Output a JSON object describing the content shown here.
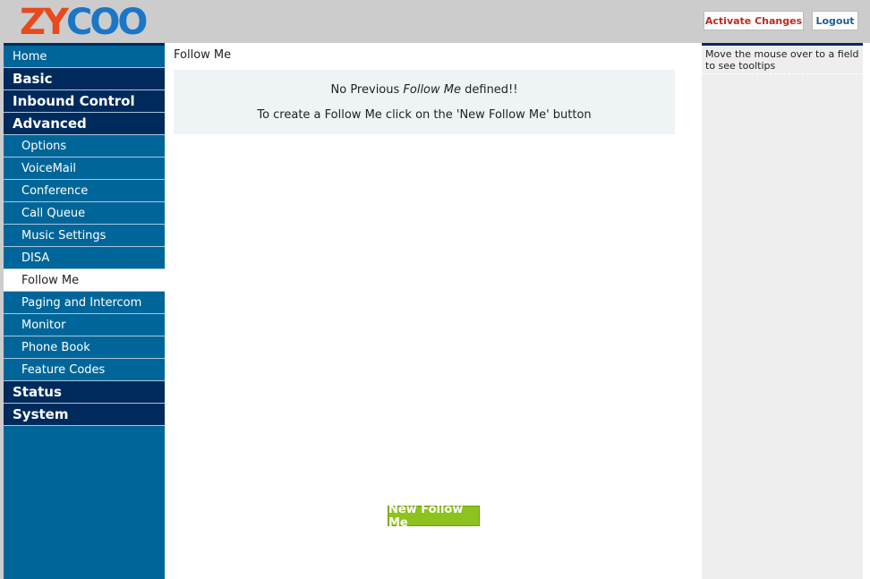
{
  "header": {
    "logo_text": "ZYCOO",
    "activate_label": "Activate Changes",
    "logout_label": "Logout"
  },
  "colors": {
    "sidebar_bg": "#006699",
    "section_bg": "#002a5c",
    "button_green": "#8dc21f",
    "activate_red": "#c0281e"
  },
  "sidebar": {
    "items": [
      {
        "label": "Home",
        "kind": "top"
      },
      {
        "label": "Basic",
        "kind": "section"
      },
      {
        "label": "Inbound Control",
        "kind": "section"
      },
      {
        "label": "Advanced",
        "kind": "section"
      },
      {
        "label": "Options",
        "kind": "sub"
      },
      {
        "label": "VoiceMail",
        "kind": "sub"
      },
      {
        "label": "Conference",
        "kind": "sub"
      },
      {
        "label": "Call Queue",
        "kind": "sub"
      },
      {
        "label": "Music Settings",
        "kind": "sub"
      },
      {
        "label": "DISA",
        "kind": "sub"
      },
      {
        "label": "Follow Me",
        "kind": "sub",
        "active": true
      },
      {
        "label": "Paging and Intercom",
        "kind": "sub"
      },
      {
        "label": "Monitor",
        "kind": "sub"
      },
      {
        "label": "Phone Book",
        "kind": "sub"
      },
      {
        "label": "Feature Codes",
        "kind": "sub"
      },
      {
        "label": "Status",
        "kind": "section"
      },
      {
        "label": "System",
        "kind": "section"
      }
    ]
  },
  "main": {
    "title": "Follow Me",
    "info_prefix": "No Previous ",
    "info_emph": "Follow Me",
    "info_suffix": " defined!!",
    "info_line2": "To create a Follow Me click on the 'New Follow Me' button",
    "new_button_label": "New Follow Me"
  },
  "tooltip": {
    "text": "Move the mouse over to a field to see tooltips"
  }
}
